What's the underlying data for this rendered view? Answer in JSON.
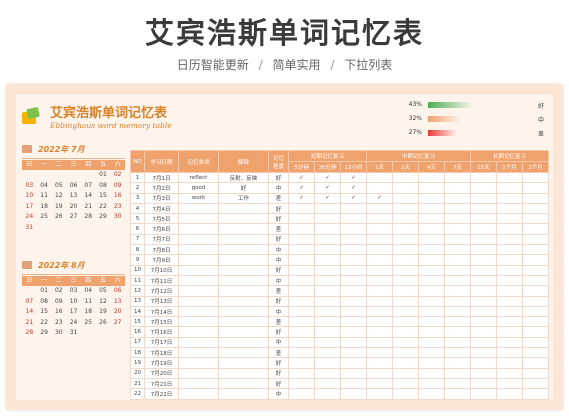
{
  "header": {
    "title": "艾宾浩斯单词记忆表",
    "subtitle_items": [
      "日历智能更新",
      "简单实用",
      "下拉列表"
    ],
    "separator": "/"
  },
  "sheet": {
    "title": "艾宾浩斯单词记忆表",
    "subtitle": "Ebbinghaus word memory table"
  },
  "legend": [
    {
      "pct": "43%",
      "label": "好",
      "fraction": 0.43,
      "color": "#4caf50"
    },
    {
      "pct": "32%",
      "label": "中",
      "fraction": 0.32,
      "color": "#f0a26c"
    },
    {
      "pct": "27%",
      "label": "差",
      "fraction": 0.27,
      "color": "#e53935"
    }
  ],
  "calendars": [
    {
      "title": "2022年  7月",
      "weekdays": [
        "日",
        "一",
        "二",
        "三",
        "四",
        "五",
        "六"
      ],
      "weeks": [
        [
          "",
          "",
          "",
          "",
          "",
          "01",
          "02"
        ],
        [
          "03",
          "04",
          "05",
          "06",
          "07",
          "08",
          "09"
        ],
        [
          "10",
          "11",
          "12",
          "13",
          "14",
          "15",
          "16"
        ],
        [
          "17",
          "18",
          "19",
          "20",
          "21",
          "22",
          "23"
        ],
        [
          "24",
          "25",
          "26",
          "27",
          "28",
          "29",
          "30"
        ],
        [
          "31",
          "",
          "",
          "",
          "",
          "",
          ""
        ]
      ]
    },
    {
      "title": "2022年  8月",
      "weekdays": [
        "日",
        "一",
        "二",
        "三",
        "四",
        "五",
        "六"
      ],
      "weeks": [
        [
          "",
          "01",
          "02",
          "03",
          "04",
          "05",
          "06"
        ],
        [
          "07",
          "08",
          "09",
          "10",
          "11",
          "12",
          "13"
        ],
        [
          "14",
          "15",
          "16",
          "17",
          "18",
          "19",
          "20"
        ],
        [
          "21",
          "22",
          "23",
          "24",
          "25",
          "26",
          "27"
        ],
        [
          "28",
          "29",
          "30",
          "31",
          "",
          "",
          ""
        ]
      ]
    }
  ],
  "table": {
    "headers": {
      "index": "NO",
      "date": "学习日期",
      "word": "记忆单词",
      "meaning": "解释",
      "rating": "记忆\n程度",
      "group_short": "短期记忆复习",
      "group_mid": "中期记忆复习",
      "group_long": "长期记忆复习",
      "short_cols": [
        "5分钟",
        "30分钟",
        "12小时"
      ],
      "mid_cols": [
        "1天",
        "2天",
        "4天",
        "7天"
      ],
      "long_cols": [
        "15天",
        "1个月",
        "3个月"
      ]
    },
    "rows": [
      {
        "no": "1",
        "date": "7月1日",
        "word": "reflect",
        "meaning": "反射、反映",
        "rating": "好",
        "checks": [
          "✓",
          "✓",
          "✓",
          "",
          "",
          "",
          "",
          "",
          "",
          ""
        ]
      },
      {
        "no": "2",
        "date": "7月2日",
        "word": "good",
        "meaning": "好",
        "rating": "中",
        "checks": [
          "✓",
          "✓",
          "✓",
          "",
          "",
          "",
          "",
          "",
          "",
          ""
        ]
      },
      {
        "no": "3",
        "date": "7月3日",
        "word": "work",
        "meaning": "工作",
        "rating": "差",
        "checks": [
          "✓",
          "✓",
          "✓",
          "✓",
          "",
          "",
          "",
          "",
          "",
          ""
        ]
      },
      {
        "no": "4",
        "date": "7月4日",
        "word": "",
        "meaning": "",
        "rating": "好",
        "checks": [
          "",
          "",
          "",
          "",
          "",
          "",
          "",
          "",
          "",
          ""
        ]
      },
      {
        "no": "5",
        "date": "7月5日",
        "word": "",
        "meaning": "",
        "rating": "好",
        "checks": [
          "",
          "",
          "",
          "",
          "",
          "",
          "",
          "",
          "",
          ""
        ]
      },
      {
        "no": "6",
        "date": "7月6日",
        "word": "",
        "meaning": "",
        "rating": "差",
        "checks": [
          "",
          "",
          "",
          "",
          "",
          "",
          "",
          "",
          "",
          ""
        ]
      },
      {
        "no": "7",
        "date": "7月7日",
        "word": "",
        "meaning": "",
        "rating": "好",
        "checks": [
          "",
          "",
          "",
          "",
          "",
          "",
          "",
          "",
          "",
          ""
        ]
      },
      {
        "no": "8",
        "date": "7月8日",
        "word": "",
        "meaning": "",
        "rating": "中",
        "checks": [
          "",
          "",
          "",
          "",
          "",
          "",
          "",
          "",
          "",
          ""
        ]
      },
      {
        "no": "9",
        "date": "7月9日",
        "word": "",
        "meaning": "",
        "rating": "中",
        "checks": [
          "",
          "",
          "",
          "",
          "",
          "",
          "",
          "",
          "",
          ""
        ]
      },
      {
        "no": "10",
        "date": "7月10日",
        "word": "",
        "meaning": "",
        "rating": "好",
        "checks": [
          "",
          "",
          "",
          "",
          "",
          "",
          "",
          "",
          "",
          ""
        ]
      },
      {
        "no": "11",
        "date": "7月11日",
        "word": "",
        "meaning": "",
        "rating": "中",
        "checks": [
          "",
          "",
          "",
          "",
          "",
          "",
          "",
          "",
          "",
          ""
        ]
      },
      {
        "no": "12",
        "date": "7月12日",
        "word": "",
        "meaning": "",
        "rating": "差",
        "checks": [
          "",
          "",
          "",
          "",
          "",
          "",
          "",
          "",
          "",
          ""
        ]
      },
      {
        "no": "13",
        "date": "7月13日",
        "word": "",
        "meaning": "",
        "rating": "好",
        "checks": [
          "",
          "",
          "",
          "",
          "",
          "",
          "",
          "",
          "",
          ""
        ]
      },
      {
        "no": "14",
        "date": "7月14日",
        "word": "",
        "meaning": "",
        "rating": "中",
        "checks": [
          "",
          "",
          "",
          "",
          "",
          "",
          "",
          "",
          "",
          ""
        ]
      },
      {
        "no": "15",
        "date": "7月15日",
        "word": "",
        "meaning": "",
        "rating": "差",
        "checks": [
          "",
          "",
          "",
          "",
          "",
          "",
          "",
          "",
          "",
          ""
        ]
      },
      {
        "no": "16",
        "date": "7月16日",
        "word": "",
        "meaning": "",
        "rating": "好",
        "checks": [
          "",
          "",
          "",
          "",
          "",
          "",
          "",
          "",
          "",
          ""
        ]
      },
      {
        "no": "17",
        "date": "7月17日",
        "word": "",
        "meaning": "",
        "rating": "中",
        "checks": [
          "",
          "",
          "",
          "",
          "",
          "",
          "",
          "",
          "",
          ""
        ]
      },
      {
        "no": "18",
        "date": "7月18日",
        "word": "",
        "meaning": "",
        "rating": "差",
        "checks": [
          "",
          "",
          "",
          "",
          "",
          "",
          "",
          "",
          "",
          ""
        ]
      },
      {
        "no": "19",
        "date": "7月19日",
        "word": "",
        "meaning": "",
        "rating": "好",
        "checks": [
          "",
          "",
          "",
          "",
          "",
          "",
          "",
          "",
          "",
          ""
        ]
      },
      {
        "no": "20",
        "date": "7月20日",
        "word": "",
        "meaning": "",
        "rating": "好",
        "checks": [
          "",
          "",
          "",
          "",
          "",
          "",
          "",
          "",
          "",
          ""
        ]
      },
      {
        "no": "21",
        "date": "7月21日",
        "word": "",
        "meaning": "",
        "rating": "好",
        "checks": [
          "",
          "",
          "",
          "",
          "",
          "",
          "",
          "",
          "",
          ""
        ]
      },
      {
        "no": "22",
        "date": "7月22日",
        "word": "",
        "meaning": "",
        "rating": "中",
        "checks": [
          "",
          "",
          "",
          "",
          "",
          "",
          "",
          "",
          "",
          ""
        ]
      }
    ]
  }
}
